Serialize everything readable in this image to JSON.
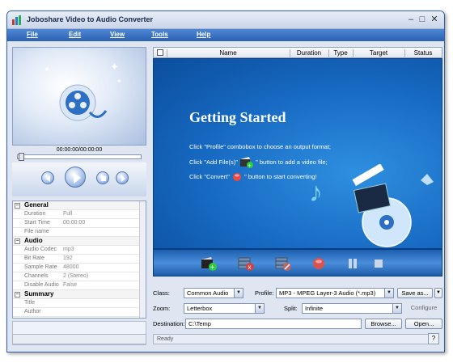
{
  "window": {
    "title": "Joboshare Video to Audio Converter",
    "minimize": "–",
    "maximize": "□",
    "close": "✕"
  },
  "menu": [
    "File",
    "Edit",
    "View",
    "Tools",
    "Help"
  ],
  "player": {
    "time": "00:00:00/00:00:00",
    "seek_progress": 0
  },
  "properties": {
    "groups": [
      {
        "name": "General",
        "rows": [
          [
            "Duration",
            "Full"
          ],
          [
            "Start Time",
            "00:00:00"
          ],
          [
            "File name",
            ""
          ]
        ]
      },
      {
        "name": "Audio",
        "rows": [
          [
            "Audio Codec",
            "mp3"
          ],
          [
            "Bit Rate",
            "192"
          ],
          [
            "Sample Rate",
            "48000"
          ],
          [
            "Channels",
            "2 (Stereo)"
          ],
          [
            "Disable Audio",
            "False"
          ]
        ]
      },
      {
        "name": "Summary",
        "rows": [
          [
            "Title",
            ""
          ],
          [
            "Author",
            ""
          ]
        ]
      }
    ]
  },
  "file_list": {
    "columns": [
      "Name",
      "Duration",
      "Type",
      "Target",
      "Status"
    ]
  },
  "getting_started": {
    "title": "Getting Started",
    "line1": "Click \"Profile\" combobox to choose an output format;",
    "line2a": "Click \"Add File(s)\"",
    "line2b": "\" button to add a video file;",
    "line3a": "Click \"Convert\"",
    "line3b": "\" button to start converting!"
  },
  "form": {
    "class_label": "Class:",
    "class_value": "Common Audio",
    "profile_label": "Profile:",
    "profile_value": "MP3 - MPEG Layer-3 Audio  (*.mp3)",
    "save_as": "Save as...",
    "zoom_label": "Zoom:",
    "zoom_value": "Letterbox",
    "split_label": "Split:",
    "split_value": "Infinite",
    "configure": "Configure",
    "destination_label": "Destination:",
    "destination_value": "C:\\Temp",
    "browse": "Browse...",
    "open": "Open..."
  },
  "status": {
    "text": "Ready",
    "help": "?"
  },
  "colors": {
    "menubar": "#2b62b3",
    "accent_blue": "#1668c0"
  }
}
